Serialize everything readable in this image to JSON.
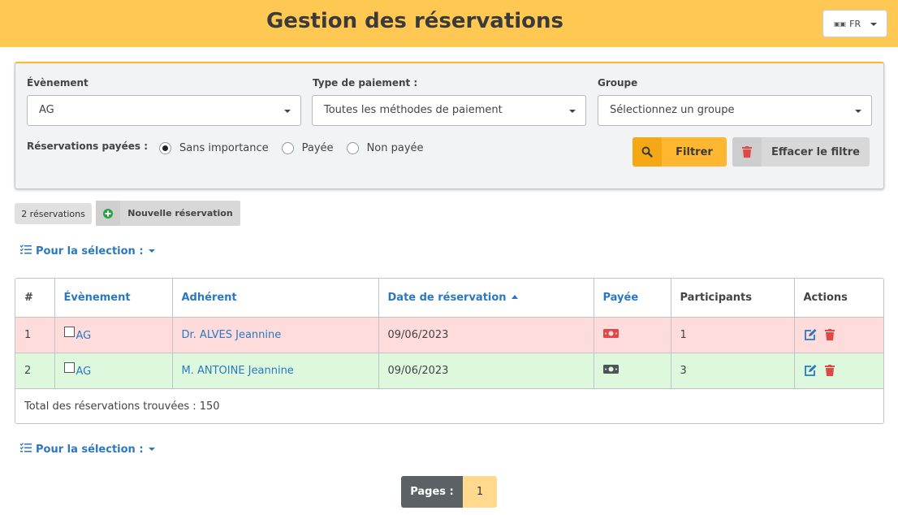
{
  "header": {
    "title": "Gestion des réservations",
    "language": "FR",
    "language_icon": "flag-icon"
  },
  "filters": {
    "event": {
      "label": "Évènement",
      "value": "AG"
    },
    "payment_type": {
      "label": "Type de paiement :",
      "value": "Toutes les méthodes de paiement"
    },
    "group": {
      "label": "Groupe",
      "placeholder": "Sélectionnez un groupe"
    },
    "paid_label": "Réservations payées :",
    "paid_options": [
      "Sans importance",
      "Payée",
      "Non payée"
    ],
    "paid_selected": "Sans importance",
    "filter_button": "Filtrer",
    "clear_button": "Effacer le filtre"
  },
  "toolbar": {
    "count": "2 réservations",
    "new_button": "Nouvelle réservation"
  },
  "selection_menu": "Pour la sélection :",
  "table": {
    "columns": [
      "#",
      "Évènement",
      "Adhérent",
      "Date de réservation",
      "Payée",
      "Participants",
      "Actions"
    ],
    "sorted_by": "Date de réservation",
    "rows": [
      {
        "num": "1",
        "event": "AG",
        "member": "Dr. ALVES Jeannine",
        "date": "09/06/2023",
        "paid": false,
        "participants": "1"
      },
      {
        "num": "2",
        "event": "AG",
        "member": "M. ANTOINE Jeannine",
        "date": "09/06/2023",
        "paid": true,
        "participants": "3"
      }
    ],
    "footer": "Total des réservations trouvées : 150"
  },
  "pagination": {
    "label": "Pages :",
    "pages": [
      "1"
    ],
    "current": "1"
  },
  "colors": {
    "header_bg": "#ffc853",
    "accent": "#ffb630",
    "link": "#2b78c2",
    "unpaid_row": "#fedcdc",
    "paid_row": "#ddf8dc",
    "danger": "#e04848"
  }
}
